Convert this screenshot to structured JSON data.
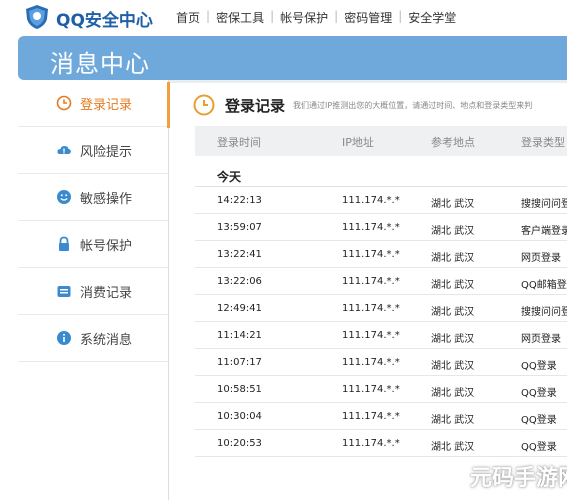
{
  "header": {
    "brand": "QQ安全中心",
    "nav": [
      "首页",
      "密保工具",
      "帐号保护",
      "密码管理",
      "安全学堂"
    ]
  },
  "banner": {
    "title": "消息中心"
  },
  "sidebar": {
    "items": [
      {
        "label": "登录记录",
        "icon": "clock-icon",
        "active": true
      },
      {
        "label": "风险提示",
        "icon": "cloud-alert-icon"
      },
      {
        "label": "敏感操作",
        "icon": "smiley-icon"
      },
      {
        "label": "帐号保护",
        "icon": "lock-icon"
      },
      {
        "label": "消费记录",
        "icon": "wallet-icon"
      },
      {
        "label": "系统消息",
        "icon": "info-icon"
      }
    ]
  },
  "main": {
    "title": "登录记录",
    "description": "我们通过IP推测出您的大概位置，请通过时间、地点和登录类型来判",
    "columns": [
      "登录时间",
      "IP地址",
      "参考地点",
      "登录类型"
    ],
    "group": "今天",
    "rows": [
      {
        "time": "14:22:13",
        "ip": "111.174.*.*",
        "place": "湖北 武汉",
        "type": "搜搜问问登"
      },
      {
        "time": "13:59:07",
        "ip": "111.174.*.*",
        "place": "湖北 武汉",
        "type": "客户端登录"
      },
      {
        "time": "13:22:41",
        "ip": "111.174.*.*",
        "place": "湖北 武汉",
        "type": "网页登录"
      },
      {
        "time": "13:22:06",
        "ip": "111.174.*.*",
        "place": "湖北 武汉",
        "type": "QQ邮箱登录"
      },
      {
        "time": "12:49:41",
        "ip": "111.174.*.*",
        "place": "湖北 武汉",
        "type": "搜搜问问登"
      },
      {
        "time": "11:14:21",
        "ip": "111.174.*.*",
        "place": "湖北 武汉",
        "type": "网页登录"
      },
      {
        "time": "11:07:17",
        "ip": "111.174.*.*",
        "place": "湖北 武汉",
        "type": "QQ登录"
      },
      {
        "time": "10:58:51",
        "ip": "111.174.*.*",
        "place": "湖北 武汉",
        "type": "QQ登录"
      },
      {
        "time": "10:30:04",
        "ip": "111.174.*.*",
        "place": "湖北 武汉",
        "type": "QQ登录"
      },
      {
        "time": "10:20:53",
        "ip": "111.174.*.*",
        "place": "湖北 武汉",
        "type": "QQ登录"
      }
    ]
  },
  "watermark": "元码手游网",
  "colors": {
    "accent": "#e57a1e",
    "banner": "#6fa9dc",
    "brand": "#1e5fa8"
  }
}
